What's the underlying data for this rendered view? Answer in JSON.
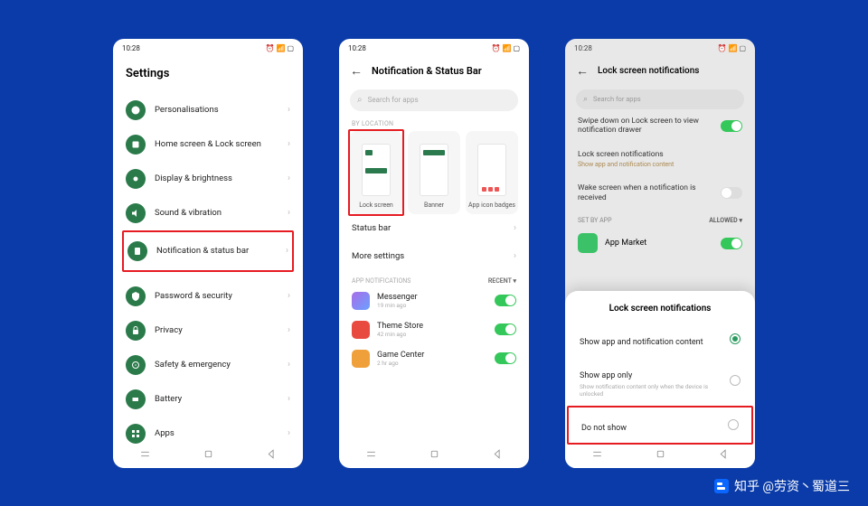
{
  "statusbar": {
    "time": "10:28"
  },
  "screen1": {
    "title": "Settings",
    "items": [
      {
        "label": "Personalisations"
      },
      {
        "label": "Home screen & Lock screen"
      },
      {
        "label": "Display & brightness"
      },
      {
        "label": "Sound & vibration"
      },
      {
        "label": "Notification & status bar"
      },
      {
        "label": "Password & security"
      },
      {
        "label": "Privacy"
      },
      {
        "label": "Safety & emergency"
      },
      {
        "label": "Battery"
      },
      {
        "label": "Apps"
      }
    ]
  },
  "screen2": {
    "title": "Notification & Status Bar",
    "search_placeholder": "Search for apps",
    "by_location": "BY LOCATION",
    "cards": {
      "lockscreen": "Lock screen",
      "banner": "Banner",
      "badges": "App icon badges"
    },
    "status_bar": "Status bar",
    "more_settings": "More settings",
    "app_notifications": "APP NOTIFICATIONS",
    "recent": "RECENT ▾",
    "apps": [
      {
        "name": "Messenger",
        "sub": "19 min ago",
        "color": "#a96de8"
      },
      {
        "name": "Theme Store",
        "sub": "42 min ago",
        "color": "#e94a3f"
      },
      {
        "name": "Game Center",
        "sub": "2 hr ago",
        "color": "#f0a03a"
      }
    ]
  },
  "screen3": {
    "title": "Lock screen notifications",
    "search_placeholder": "Search for apps",
    "swipe": "Swipe down on Lock screen to view notification drawer",
    "lsn_row": "Lock screen notifications",
    "lsn_sub": "Show app and notification content",
    "wake": "Wake screen when a notification is received",
    "set_by_app": "SET BY APP",
    "allowed": "ALLOWED ▾",
    "app_market": "App Market",
    "sheet_title": "Lock screen notifications",
    "opt1": "Show app and notification content",
    "opt2": "Show app only",
    "opt2_sub": "Show notification content only when the device is unlocked",
    "opt3": "Do not show"
  },
  "watermark": "知乎 @劳资丶蜀道三"
}
